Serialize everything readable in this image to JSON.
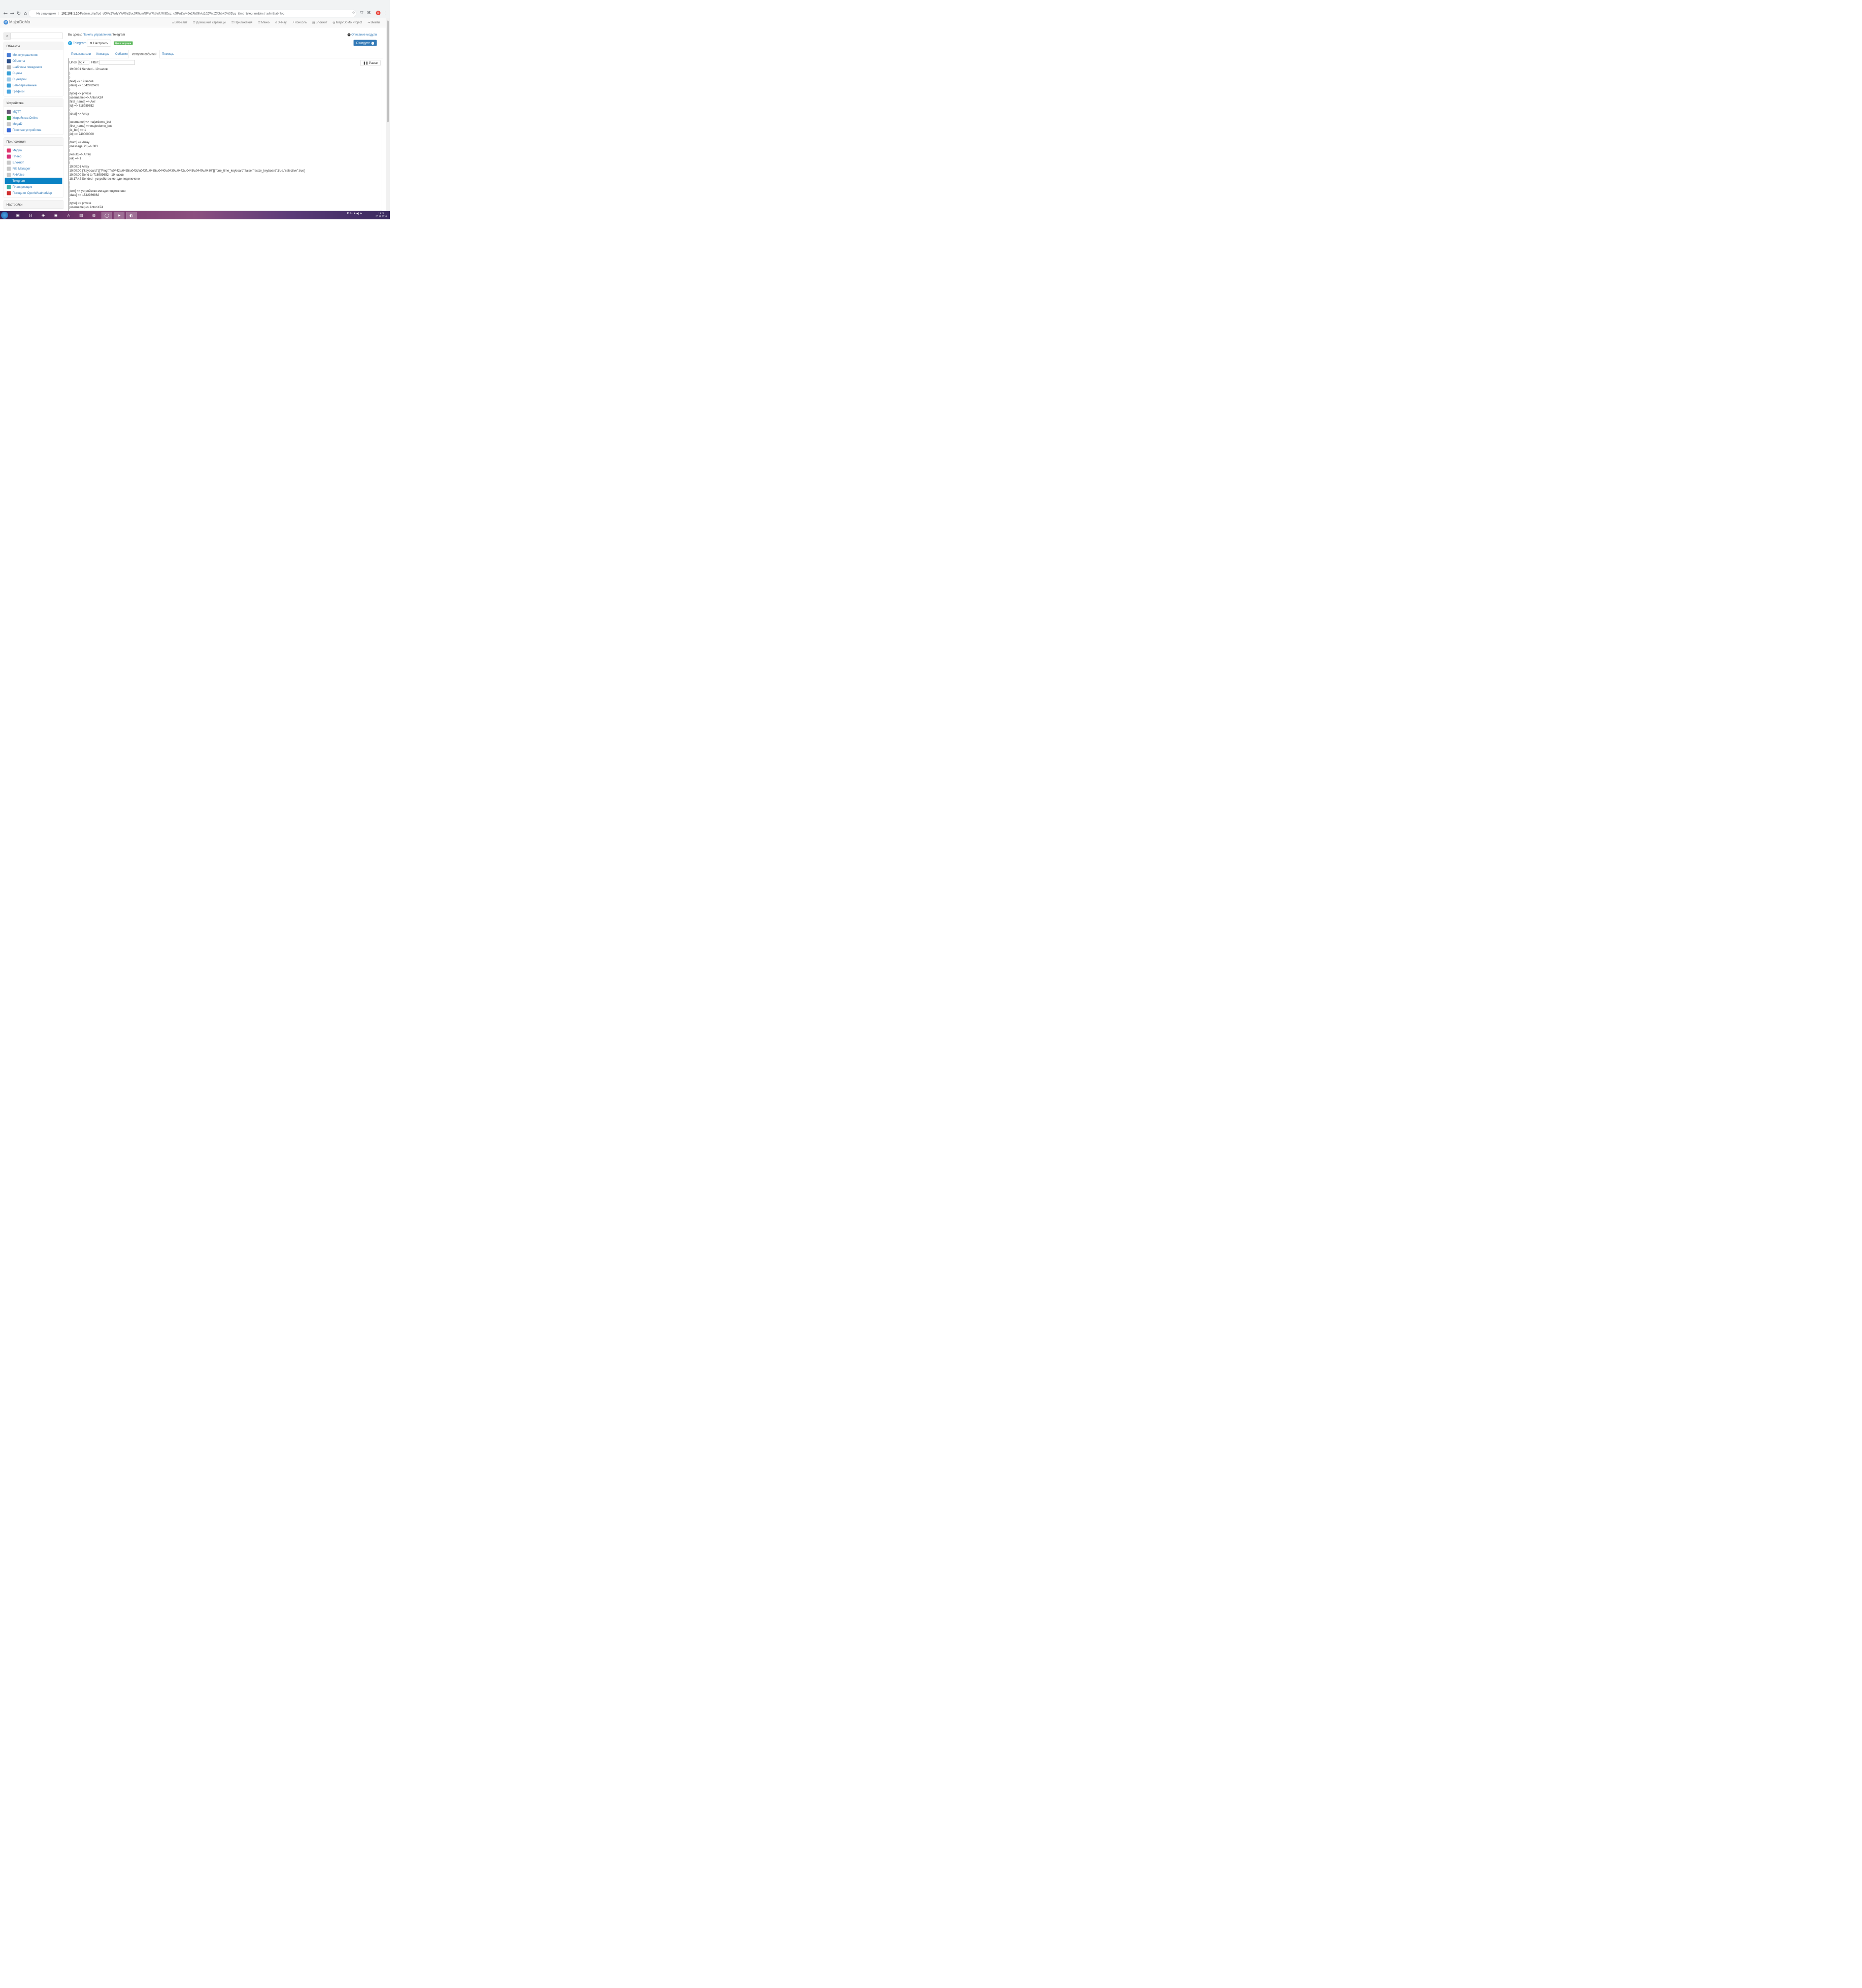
{
  "browser": {
    "security_label": "Не защищено",
    "url_host": "192.168.1.104",
    "url_rest": "/admin.php?pd=dGVsZWdyYW06e2luc3RhbmNlPWFkbWlJ%3Dpz_cGFuZWw6e2FjdGlvbj10ZWxlZ3JhbX0%3Dpz_&md=telegram&inst=adm&tab=log",
    "profile_letter": "Б"
  },
  "app": {
    "brand": "MajorDoMo",
    "menu": [
      {
        "icon": "⌂",
        "label": "Веб-сайт"
      },
      {
        "icon": "☰",
        "label": "Домашние страницы"
      },
      {
        "icon": "☰",
        "label": "Приложения"
      },
      {
        "icon": "☰",
        "label": "Меню"
      },
      {
        "icon": "⊙",
        "label": "X-Ray"
      },
      {
        "icon": "⚡",
        "label": "Консоль"
      },
      {
        "icon": "▤",
        "label": "Блокнот"
      },
      {
        "icon": "◍",
        "label": "MajorDoMo Project"
      },
      {
        "icon": "↪",
        "label": "Выйти"
      }
    ]
  },
  "sidebar": {
    "sections": [
      {
        "title": "Объекты",
        "items": [
          {
            "label": "Меню управления",
            "color": "#4a7ed6"
          },
          {
            "label": "Объекты",
            "color": "#2c4f8a"
          },
          {
            "label": "Шаблоны поведения",
            "color": "#b0b0b0"
          },
          {
            "label": "Сцены",
            "color": "#39a0d6"
          },
          {
            "label": "Сценарии",
            "color": "#9ecbe8"
          },
          {
            "label": "Веб-переменные",
            "color": "#3ea0d8"
          },
          {
            "label": "Графики",
            "color": "#4aa6e0"
          }
        ]
      },
      {
        "title": "Устройства",
        "items": [
          {
            "label": "MQTT",
            "color": "#6a5a7a"
          },
          {
            "label": "Устройства Online",
            "color": "#2e9a3a"
          },
          {
            "label": "MegaD",
            "color": "#c8c8c8"
          },
          {
            "label": "Простые устройства",
            "color": "#3a6ad8"
          }
        ]
      },
      {
        "title": "Приложения",
        "items": [
          {
            "label": "Медиа",
            "color": "#e0336b"
          },
          {
            "label": "Плеер",
            "color": "#d8327a"
          },
          {
            "label": "Блокнот",
            "color": "#c8c8c8"
          },
          {
            "label": "File Manager",
            "color": "#c8c8c8"
          },
          {
            "label": "RHVoice",
            "color": "#c8c8c8"
          },
          {
            "label": "Telegram",
            "color": "#0a82c4",
            "active": true
          },
          {
            "label": "Планировщик",
            "color": "#40b3a8"
          },
          {
            "label": "Погода от OpenWeatherMap",
            "color": "#d03030"
          }
        ]
      }
    ],
    "next_section": "Настройки"
  },
  "main": {
    "breadcrumb_prefix": "Вы здесь:",
    "breadcrumb_link": "Панель управления",
    "breadcrumb_sep": "/",
    "breadcrumb_current": "telegram",
    "module_desc": "Описание модуля",
    "module_title": "Telegram",
    "configure_label": "Настроить",
    "cycle_badge": "Цикл запущен",
    "about_label": "О модуле",
    "tabs": [
      "Пользователи",
      "Команды",
      "События",
      "История событий",
      "Помощь"
    ],
    "active_tab": 3,
    "lines_label": "Lines:",
    "lines_value": "50",
    "filter_label": "Filter:",
    "pause_label": "Pause",
    "log_lines": [
      "19:00:01 Sended - 19 часов",
      ")",
      ")",
      "[text] => 19 часов",
      "[date] => 1542992401",
      ")",
      "[type] => private",
      "[username] => AntonXZ4",
      "[first_name] => Ант",
      "[id] => 718989652",
      "(",
      "[chat] => Array",
      ")",
      "[username] => majordomo_bot",
      "[first_name] => majordomo_bot",
      "[is_bot] => 1",
      "[id] => 740000000",
      "(",
      "[from] => Array",
      "[message_id] => 303",
      "(",
      "[result] => Array",
      "[ok] => 1",
      "(",
      "19:00:01 Array",
      "19:00:00 {\"keyboard\":[[\"Ping\",\"\\u0442\\u0435\\u043c\\u043f\\u0435\\u0440\\u0430\\u0442\\u0443\\u0440\\u0430\"]],\"one_time_keyboard\":false,\"resize_keyboard\":true,\"selective\":true}",
      "19:00:00 Send to 718989652 - 19 часов",
      "18:17:42 Sended - устройство мегаде подключено",
      ")",
      ")",
      "[text] => устройство мегаде подключено",
      "[date] => 1542989862",
      ")",
      "[type] => private",
      "[username] => AntonXZ4"
    ]
  },
  "taskbar": {
    "items": [
      {
        "icon": "▣"
      },
      {
        "icon": "◎"
      },
      {
        "icon": "◈"
      },
      {
        "icon": "◉"
      },
      {
        "icon": "◬"
      },
      {
        "icon": "▤"
      },
      {
        "icon": "◍"
      },
      {
        "icon": "◯",
        "highlight": true
      },
      {
        "icon": "➤",
        "highlight": true
      },
      {
        "icon": "◐",
        "highlight": true
      }
    ],
    "lang": "RU",
    "time": "19:21",
    "date": "23.11.2018"
  }
}
